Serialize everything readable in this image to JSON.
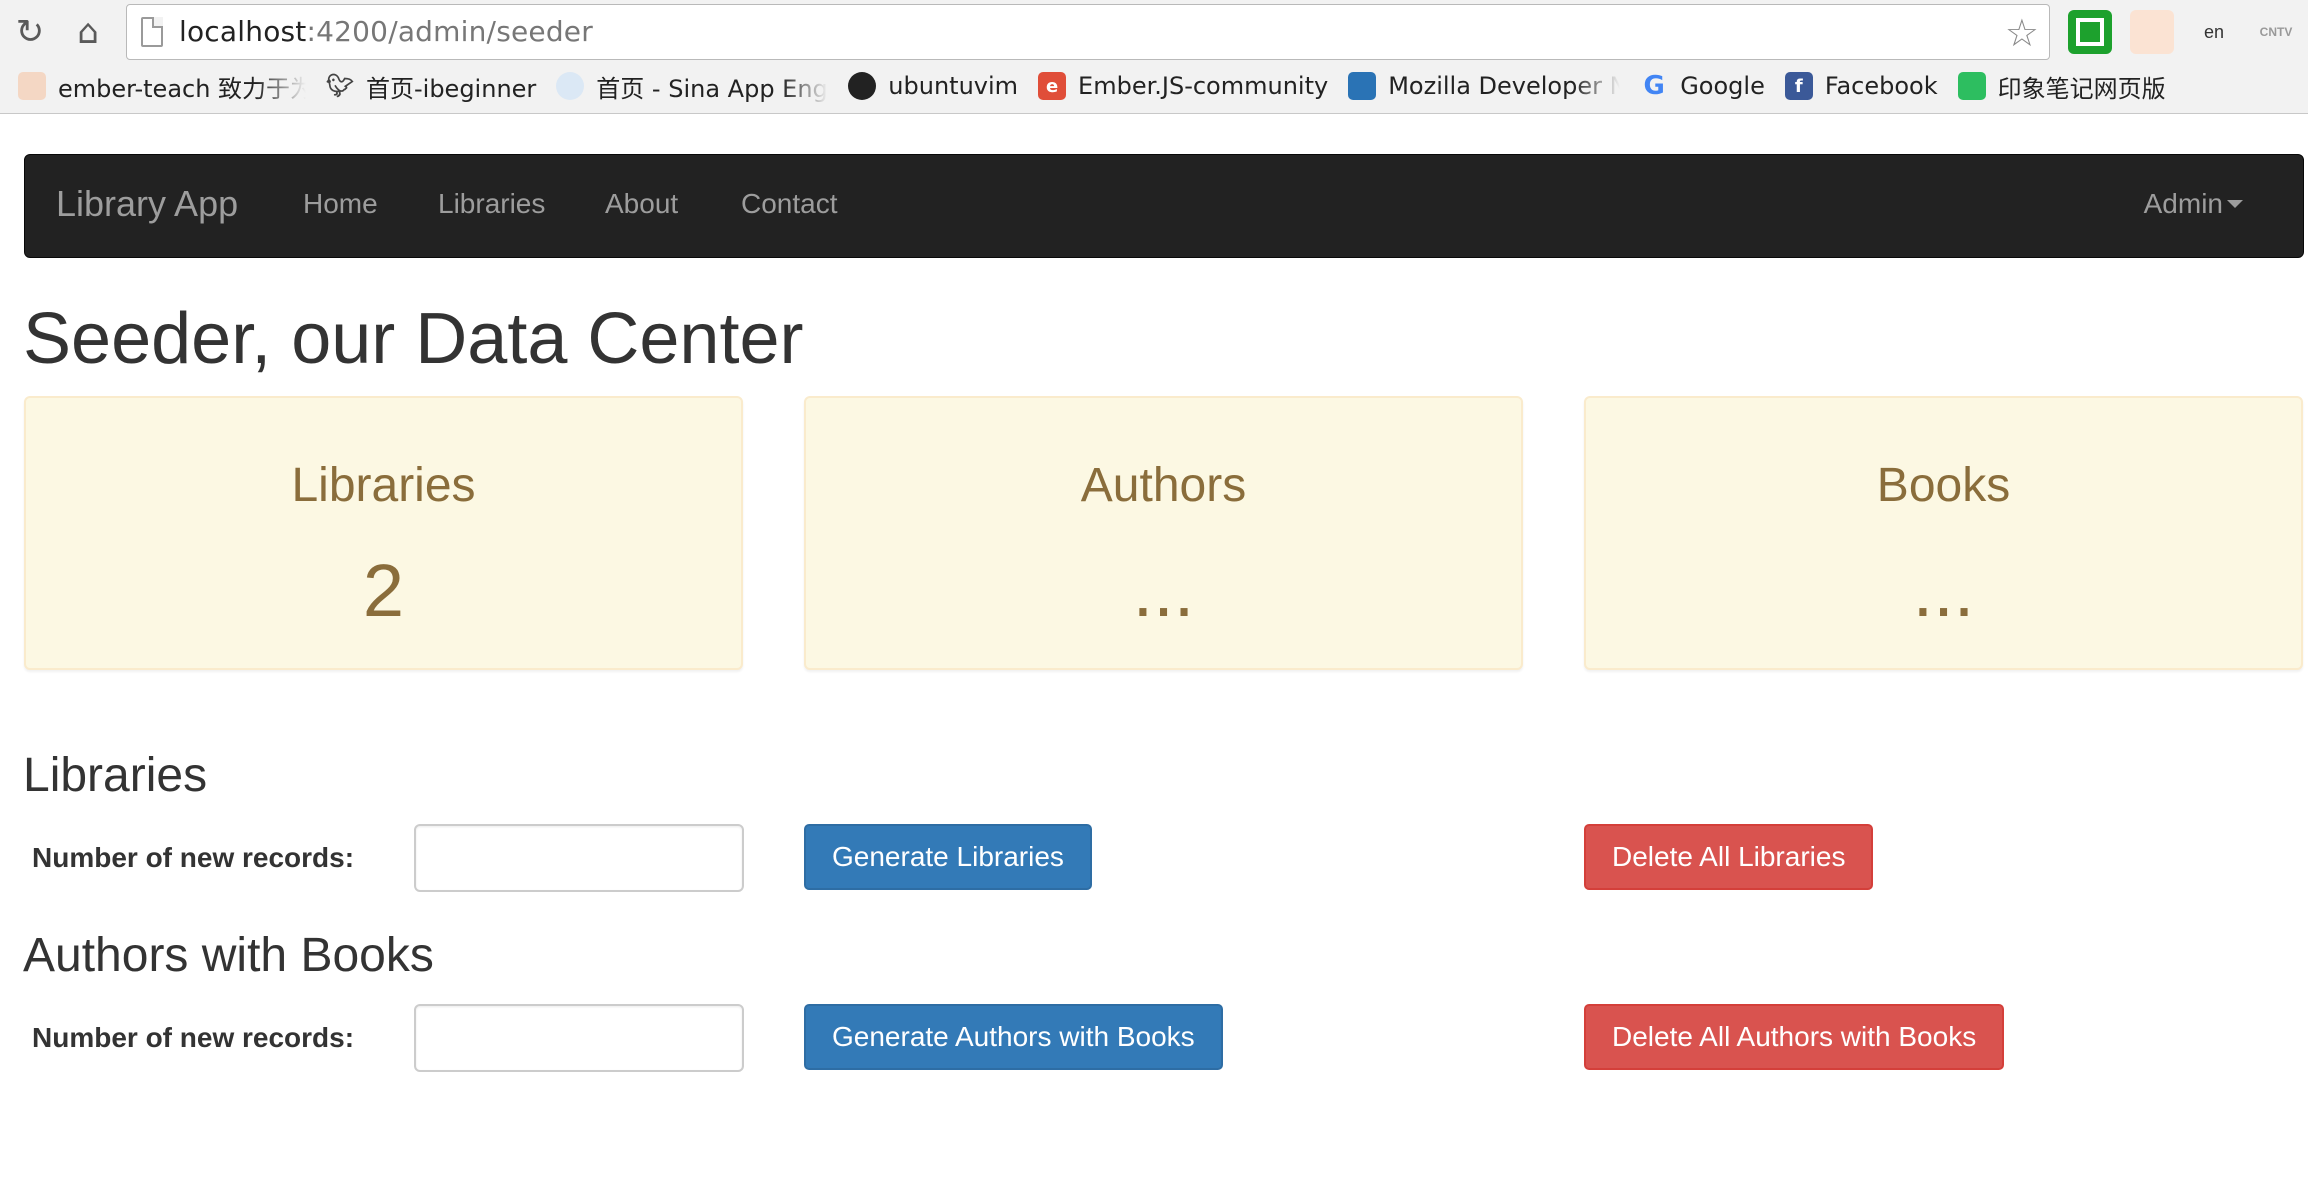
{
  "browser": {
    "url_host": "localhost",
    "url_rest": ":4200/admin/seeder",
    "bookmarks": [
      {
        "label": "ember-teach  致力于为",
        "icon_color": "#c0392b",
        "icon": "ember-teach-icon"
      },
      {
        "label": "首页-ibeginner",
        "icon_color": "#555555",
        "icon": "bird-icon"
      },
      {
        "label": "首页 - Sina App Engine",
        "icon_color": "#6fa8dc",
        "icon": "cloud-icon"
      },
      {
        "label": "ubuntuvim",
        "icon_color": "#222222",
        "icon": "github-icon"
      },
      {
        "label": "Ember.JS-community",
        "icon_color": "#e04e39",
        "icon": "ember-icon"
      },
      {
        "label": "Mozilla Developer Network",
        "icon_color": "#2a73b5",
        "icon": "mdn-icon"
      },
      {
        "label": "Google",
        "icon_color": "#4285f4",
        "icon": "google-icon"
      },
      {
        "label": "Facebook",
        "icon_color": "#3b5998",
        "icon": "facebook-icon"
      },
      {
        "label": "印象笔记网页版",
        "icon_color": "#2dbe60",
        "icon": "evernote-icon"
      }
    ]
  },
  "navbar": {
    "brand": "Library App",
    "links": [
      "Home",
      "Libraries",
      "About",
      "Contact"
    ],
    "admin": "Admin"
  },
  "page": {
    "title": "Seeder, our Data Center"
  },
  "stats": [
    {
      "title": "Libraries",
      "value": "2"
    },
    {
      "title": "Authors",
      "value": "..."
    },
    {
      "title": "Books",
      "value": "..."
    }
  ],
  "libraries_section": {
    "heading": "Libraries",
    "label": "Number of new records:",
    "input_value": "",
    "generate": "Generate Libraries",
    "delete": "Delete All Libraries"
  },
  "authors_section": {
    "heading": "Authors with Books",
    "label": "Number of new records:",
    "input_value": "",
    "generate": "Generate Authors with Books",
    "delete": "Delete All Authors with Books"
  },
  "colors": {
    "primary": "#337ab7",
    "danger": "#d9534f",
    "warning_bg": "#fcf8e3",
    "warning_text": "#8a6d3b",
    "navbar_bg": "#222222"
  }
}
